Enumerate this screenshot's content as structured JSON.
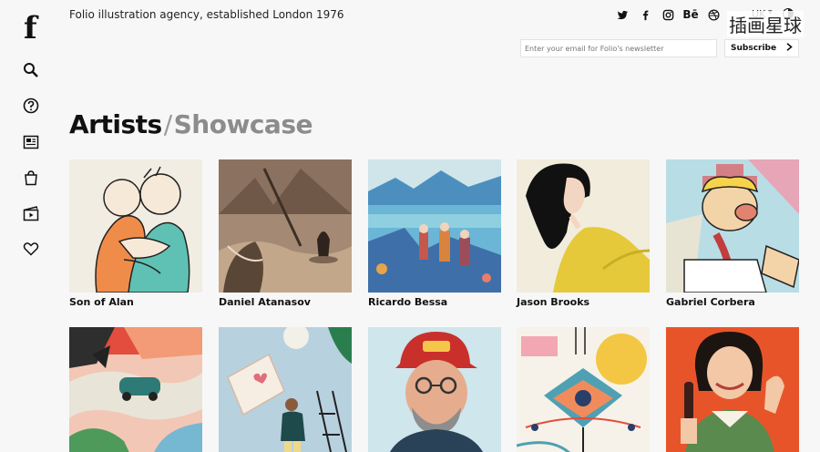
{
  "header": {
    "tagline": "Folio illustration agency, established London 1976",
    "language": "UK",
    "watermark": "插画星球"
  },
  "newsletter": {
    "placeholder": "Enter your email for Folio's newsletter",
    "button_label": "Subscribe"
  },
  "social": [
    "twitter-icon",
    "facebook-icon",
    "instagram-icon",
    "behance-icon",
    "dribbble-icon"
  ],
  "behance_text": "Bē",
  "sidebar": {
    "logo": "f",
    "items": [
      "search-icon",
      "help-icon",
      "news-icon",
      "shopping-bag-icon",
      "video-icon",
      "heart-icon"
    ]
  },
  "page": {
    "title_primary": "Artists",
    "separator": "/",
    "title_secondary": "Showcase"
  },
  "artists": [
    {
      "name": "Son of Alan"
    },
    {
      "name": "Daniel Atanasov"
    },
    {
      "name": "Ricardo Bessa"
    },
    {
      "name": "Jason Brooks"
    },
    {
      "name": "Gabriel Corbera"
    },
    {
      "name": ""
    },
    {
      "name": ""
    },
    {
      "name": ""
    },
    {
      "name": ""
    },
    {
      "name": ""
    }
  ]
}
